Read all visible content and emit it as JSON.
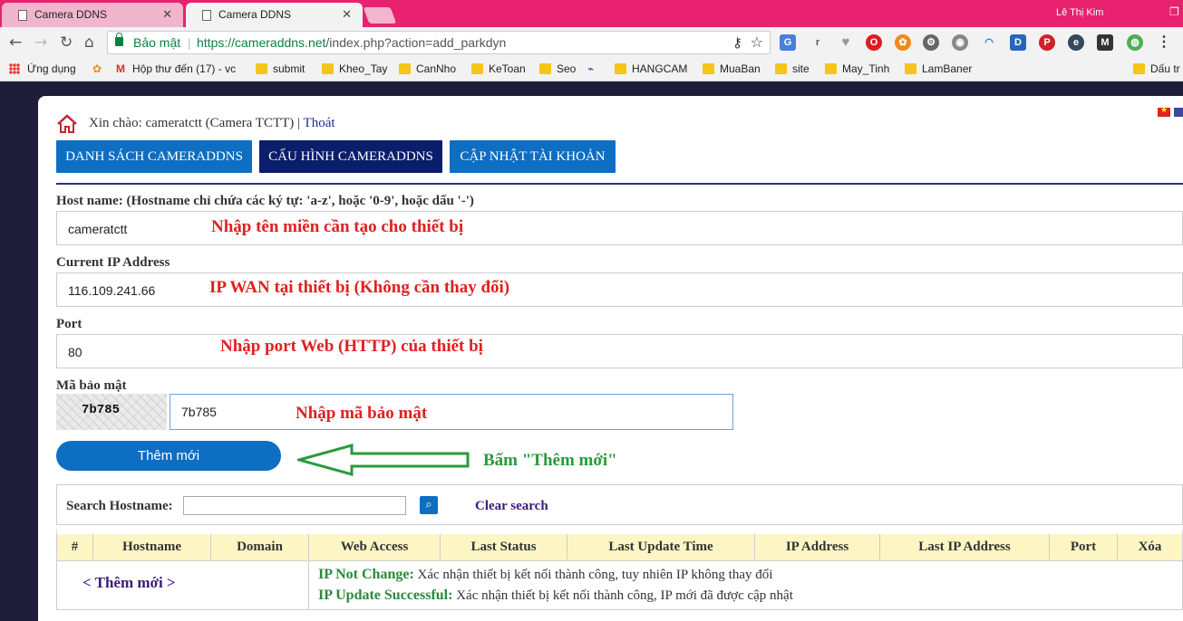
{
  "browser": {
    "tabs": [
      {
        "title": "Camera DDNS",
        "active": false
      },
      {
        "title": "Camera DDNS",
        "active": true
      }
    ],
    "user": "Lê Thị Kim",
    "security_label": "Bảo mật",
    "url_base": "https://cameraddns.net",
    "url_path": "/index.php?action=add_parkdyn",
    "bookmarks": [
      {
        "label": "Ứng dụng",
        "icon": "apps-icon"
      },
      {
        "label": "",
        "icon": "flower-icon"
      },
      {
        "label": "Hộp thư đến (17) - vc",
        "icon": "gmail-icon"
      },
      {
        "label": "submit",
        "icon": "folder-icon"
      },
      {
        "label": "Kheo_Tay",
        "icon": "folder-icon"
      },
      {
        "label": "CanNho",
        "icon": "folder-icon"
      },
      {
        "label": "KeToan",
        "icon": "folder-icon"
      },
      {
        "label": "Seo",
        "icon": "folder-icon"
      },
      {
        "label": "",
        "icon": "bird-icon"
      },
      {
        "label": "HANGCAM",
        "icon": "folder-icon"
      },
      {
        "label": "MuaBan",
        "icon": "folder-icon"
      },
      {
        "label": "site",
        "icon": "folder-icon"
      },
      {
        "label": "May_Tinh",
        "icon": "folder-icon"
      },
      {
        "label": "LamBaner",
        "icon": "folder-icon"
      },
      {
        "label": "Dấu tr",
        "icon": "folder-icon"
      }
    ]
  },
  "header": {
    "greeting": "Xin chào: cameratctt (Camera TCTT) |",
    "logout": "Thoát"
  },
  "nav": [
    {
      "label": "DANH SÁCH CAMERADDNS",
      "active": false
    },
    {
      "label": "CẤU HÌNH CAMERADDNS",
      "active": true
    },
    {
      "label": "CẬP NHẬT TÀI KHOẢN",
      "active": false
    }
  ],
  "form": {
    "hostname_label": "Host name: (Hostname chỉ chứa các ký tự: 'a-z', hoặc '0-9', hoặc dấu '-')",
    "hostname_value": "cameratctt",
    "hostname_note": "Nhập tên miền cần tạo cho thiết bị",
    "ip_label": "Current IP Address",
    "ip_value": "116.109.241.66",
    "ip_note": "IP WAN tại thiết bị (Không cần thay đổi)",
    "port_label": "Port",
    "port_value": "80",
    "port_note": "Nhập port Web (HTTP) của thiết bị",
    "code_label": "Mã bảo mật",
    "captcha_text": "7b785",
    "code_value": "7b785",
    "code_note": "Nhập mã bảo mật",
    "submit_label": "Thêm mới",
    "submit_note": "Bấm \"Thêm mới\""
  },
  "search": {
    "label": "Search Hostname:",
    "value": "",
    "clear_label": "Clear search"
  },
  "table": {
    "columns": [
      "#",
      "Hostname",
      "Domain",
      "Web Access",
      "Last Status",
      "Last Update Time",
      "IP Address",
      "Last IP Address",
      "Port",
      "Xóa"
    ],
    "add_link": "< Thêm mới >",
    "legend": [
      {
        "term": "IP Not Change:",
        "desc": "Xác nhận thiết bị kết nối thành công, tuy nhiên IP không thay đổi"
      },
      {
        "term": "IP Update Successful:",
        "desc": "Xác nhận thiết bị kết nối thành công, IP mới đã được cập nhật"
      }
    ]
  },
  "colors": {
    "titlebar": "#e8226f",
    "button_blue": "#0d6ec2",
    "button_active": "#0a1e6b",
    "note_red": "#e02020",
    "note_green": "#2a9a3a"
  }
}
